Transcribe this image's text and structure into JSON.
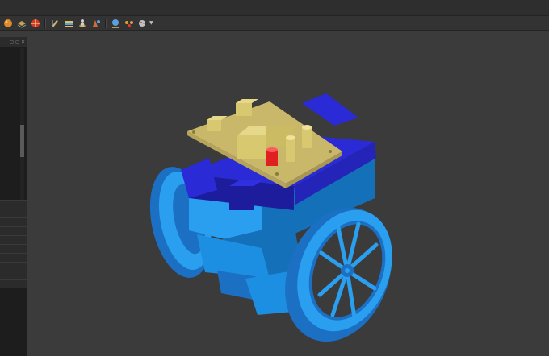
{
  "toolbar": {
    "buttons": [
      {
        "name": "sphere-orange-icon",
        "color": "#e08a2a"
      },
      {
        "name": "layers-icon",
        "color": "#c9a24a"
      },
      {
        "name": "target-red-icon",
        "color": "#d9392b"
      },
      {
        "name": "ruler-icon",
        "color": "#d6b25a"
      },
      {
        "name": "stack-icon",
        "color": "#e0c060"
      },
      {
        "name": "person-icon",
        "color": "#cfcfcf"
      },
      {
        "name": "shapes-icon",
        "color": "#d46a3a"
      },
      {
        "name": "globe-icon",
        "color": "#5aa0e0"
      },
      {
        "name": "lights-icon",
        "color": "#e0a030"
      },
      {
        "name": "paint-icon",
        "color": "#c0c0c0"
      }
    ]
  },
  "model": {
    "name": "two-wheeled-robot",
    "colors": {
      "chassis": "#1c8fe3",
      "chassis_dark": "#1470b8",
      "wheel": "#2a9ff0",
      "wheel_dark": "#1b70c4",
      "top_deck": "#2a2ad6",
      "top_deck_dark": "#1c1c9c",
      "board": "#c9b86a",
      "board_dark": "#a8974f",
      "component": "#d8c870",
      "led": "#e02020"
    }
  }
}
